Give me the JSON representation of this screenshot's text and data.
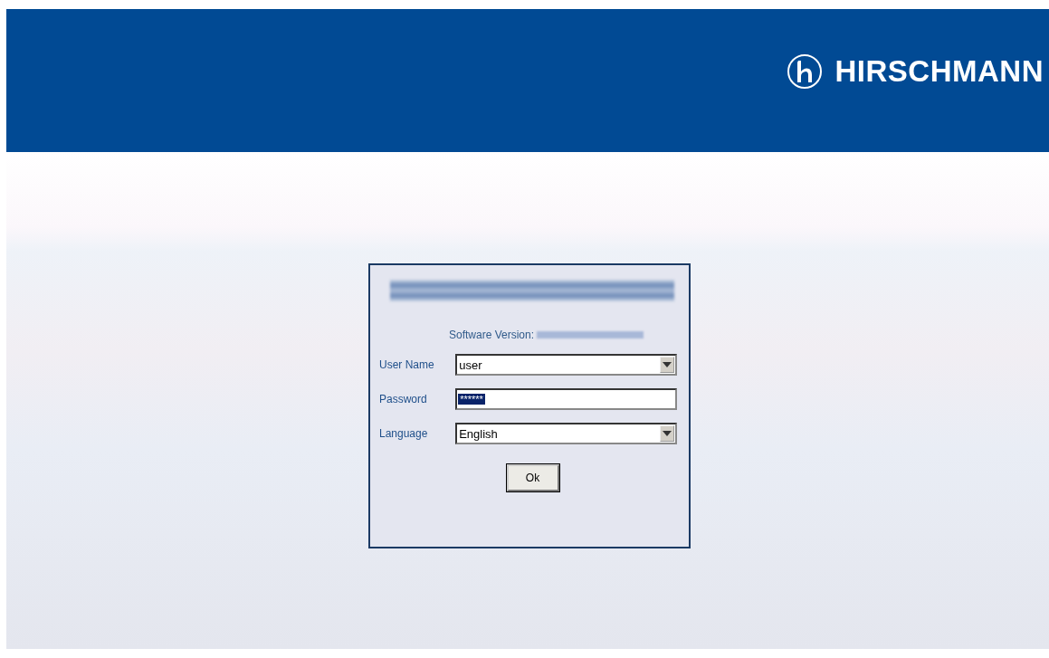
{
  "header": {
    "brand": "HIRSCHMANN"
  },
  "login": {
    "software_version_label": "Software Version:",
    "fields": [
      {
        "kind": "dropdown",
        "label": "User Name",
        "value": "user"
      },
      {
        "kind": "password",
        "label": "Password",
        "value": "******",
        "selected": true
      },
      {
        "kind": "dropdown",
        "label": "Language",
        "value": "English"
      }
    ],
    "button": "Ok"
  }
}
